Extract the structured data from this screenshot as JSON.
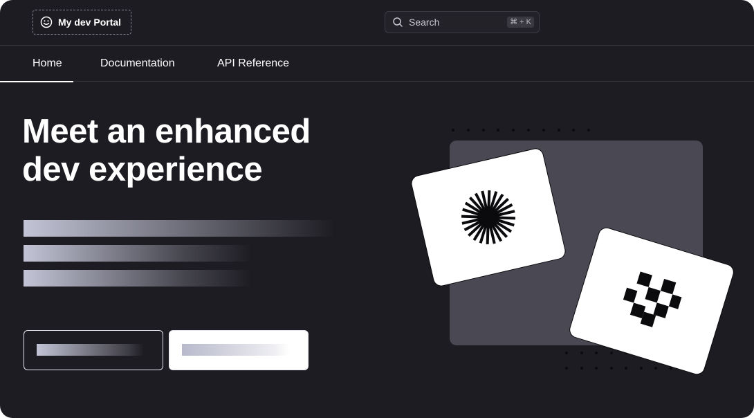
{
  "header": {
    "logo_label": "My dev Portal",
    "logo_icon": "smiley-icon",
    "search": {
      "label": "Search",
      "shortcut": "⌘ + K",
      "icon": "search-icon"
    }
  },
  "nav": {
    "tabs": [
      {
        "label": "Home",
        "active": true
      },
      {
        "label": "Documentation",
        "active": false
      },
      {
        "label": "API Reference",
        "active": false
      }
    ]
  },
  "hero": {
    "headline_line1": "Meet an enhanced",
    "headline_line2": "dev experience"
  },
  "illustration": {
    "card1_icon": "starburst-icon",
    "card2_icon": "checkerboard-icon"
  },
  "colors": {
    "background": "#1d1c22",
    "panel": "#4a4853",
    "placeholder": "#c3c4d6",
    "text": "#ffffff"
  }
}
